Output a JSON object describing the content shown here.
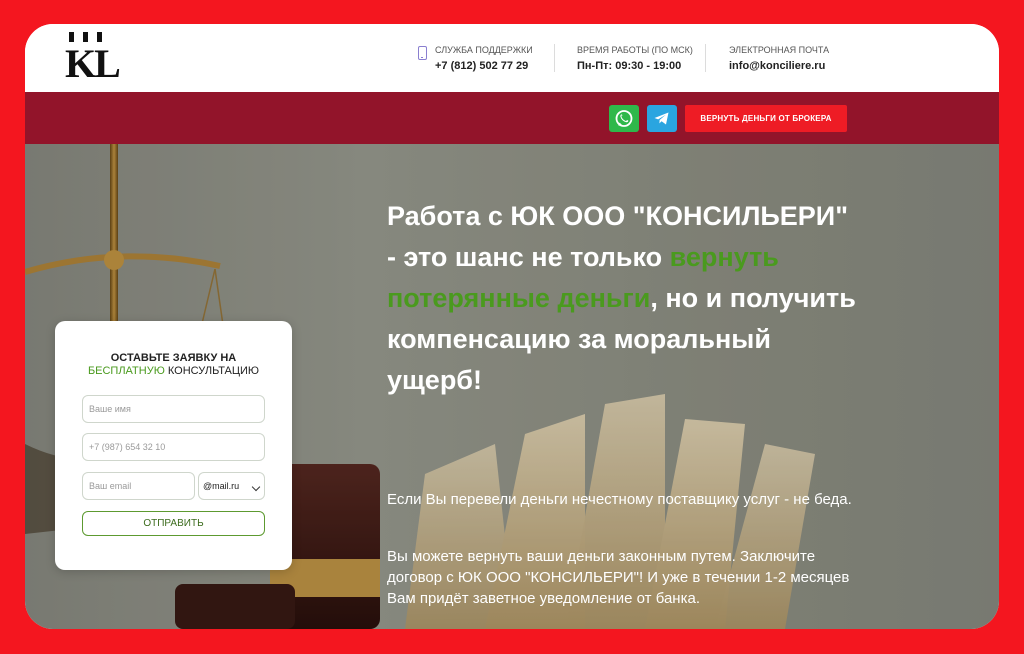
{
  "header": {
    "logo": "KL",
    "support": {
      "label": "СЛУЖБА ПОДДЕРЖКИ",
      "value": "+7 (812) 502 77 29"
    },
    "hours": {
      "label": "ВРЕМЯ РАБОТЫ (по Мск)",
      "value": "Пн-Пт: 09:30 - 19:00"
    },
    "email": {
      "label": "ЭЛЕКТРОННАЯ ПОЧТА",
      "value": "info@konciliere.ru"
    }
  },
  "bar": {
    "broker_button": "ВЕРНУТЬ ДЕНЬГИ ОТ БРОКЕРА",
    "whatsapp_icon": "whatsapp-icon",
    "telegram_icon": "telegram-icon",
    "colors": {
      "bar": "#92142a",
      "button": "#ee1c25",
      "whatsapp": "#2fb84a",
      "telegram": "#2aa5e0"
    }
  },
  "hero": {
    "headline_1": "Работа с ЮК ООО \"КОНСИЛЬЕРИ\" - это шанс не только ",
    "headline_highlight": "вернуть потерянные деньги",
    "headline_2": ", но и получить компенсацию за моральный ущерб!",
    "paragraph_1": "Если Вы перевели деньги нечестному поставщику услуг - не беда.",
    "paragraph_2": "Вы можете вернуть ваши деньги законным путем. Заключите договор с ЮК ООО \"КОНСИЛЬЕРИ\"! И уже в течении 1-2 месяцев Вам придёт заветное уведомление от банка.",
    "accent_color": "#4a9a1e"
  },
  "form": {
    "title_1": "ОСТАВЬТЕ ЗАЯВКУ НА",
    "title_free": "БЕСПЛАТНУЮ",
    "title_2": "КОНСУЛЬТАЦИЮ",
    "name_placeholder": "Ваше имя",
    "phone_placeholder": "+7 (987) 654 32 10",
    "email_placeholder": "Ваш email",
    "domain_selected": "@mail.ru",
    "submit": "ОТПРАВИТЬ"
  }
}
